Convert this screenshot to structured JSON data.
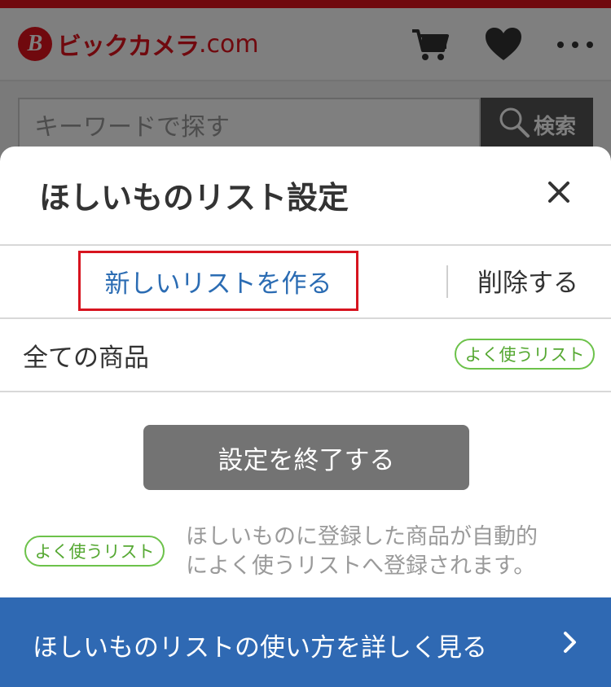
{
  "header": {
    "logo_mark": "B",
    "logo_text": "ビックカメラ",
    "logo_domain": ".com",
    "icons": [
      "cart-icon",
      "heart-icon",
      "more-icon"
    ]
  },
  "search": {
    "placeholder": "キーワードで探す",
    "button_label": "検索"
  },
  "modal": {
    "title": "ほしいものリスト設定",
    "close_icon": "close-icon",
    "new_list_label": "新しいリストを作る",
    "delete_label": "削除する",
    "list_row": {
      "label": "全ての商品",
      "badge": "よく使うリスト"
    },
    "finish_label": "設定を終了する",
    "note_badge": "よく使うリスト",
    "note_line1": "ほしいものに登録した商品が自動的",
    "note_line2": "によく使うリストへ登録されます。",
    "guide_label": "ほしいものリストの使い方を詳しく見る"
  },
  "colors": {
    "brand_red": "#e1121c",
    "link_blue": "#2b6cb3",
    "guide_blue": "#2f69b3",
    "badge_green": "#6cc24a",
    "finish_gray": "#737373"
  }
}
